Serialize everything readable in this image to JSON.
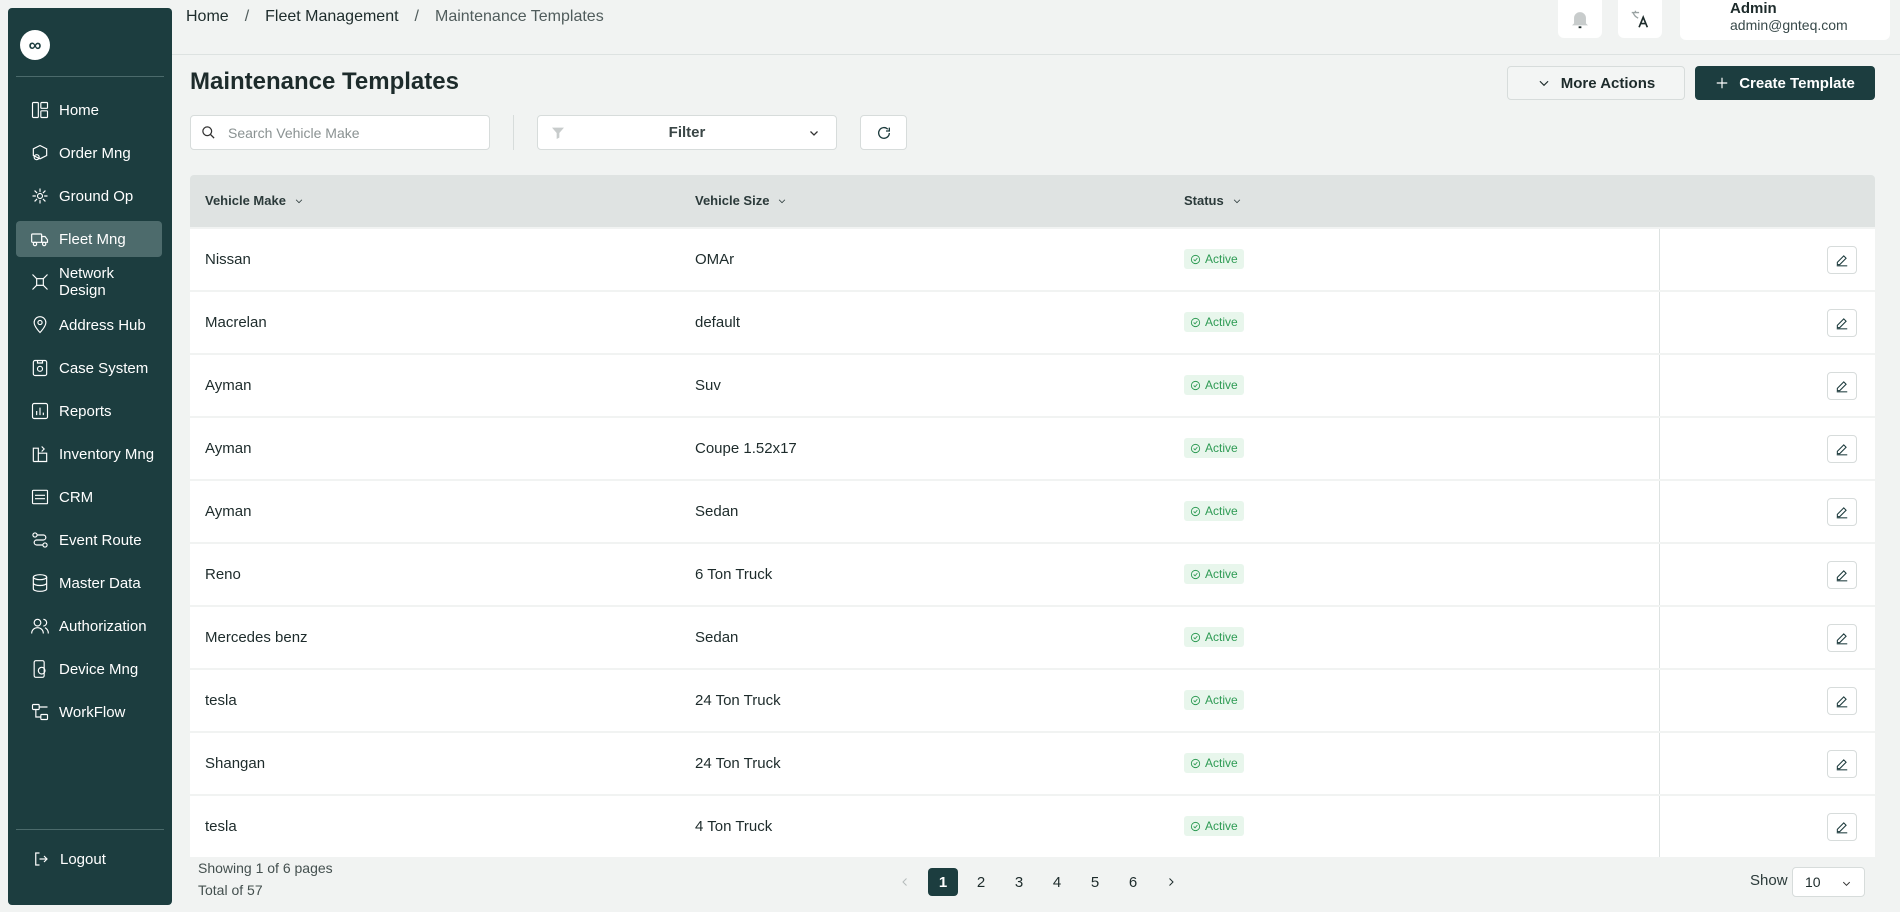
{
  "breadcrumb": {
    "home": "Home",
    "section": "Fleet Management",
    "current": "Maintenance Templates",
    "separator": "/"
  },
  "user": {
    "name": "Admin",
    "email": "admin@gnteq.com"
  },
  "sidebar": {
    "logo": "∞",
    "items": [
      {
        "label": "Home",
        "icon": "layout-grid-icon"
      },
      {
        "label": "Order Mng",
        "icon": "order-box-icon"
      },
      {
        "label": "Ground Op",
        "icon": "hub-network-icon"
      },
      {
        "label": "Fleet Mng",
        "icon": "truck-icon"
      },
      {
        "label": "Network Design",
        "icon": "network-icon"
      },
      {
        "label": "Address Hub",
        "icon": "map-pin-icon"
      },
      {
        "label": "Case System",
        "icon": "case-icon"
      },
      {
        "label": "Reports",
        "icon": "chart-icon"
      },
      {
        "label": "Inventory Mng",
        "icon": "inventory-icon"
      },
      {
        "label": "CRM",
        "icon": "crm-icon"
      },
      {
        "label": "Event Route",
        "icon": "route-icon"
      },
      {
        "label": "Master Data",
        "icon": "database-icon"
      },
      {
        "label": "Authorization",
        "icon": "users-icon"
      },
      {
        "label": "Device Mng",
        "icon": "device-gear-icon"
      },
      {
        "label": "WorkFlow",
        "icon": "workflow-icon"
      }
    ],
    "active": "Fleet Mng",
    "logout": "Logout"
  },
  "page": {
    "title": "Maintenance Templates"
  },
  "actions": {
    "more": "More Actions",
    "create": "Create Template"
  },
  "toolbar": {
    "search_placeholder": "Search Vehicle Make",
    "filter_label": "Filter"
  },
  "table": {
    "headers": {
      "make": "Vehicle Make",
      "size": "Vehicle Size",
      "status": "Status"
    },
    "rows": [
      {
        "make": "Nissan",
        "size": "OMAr",
        "status": "Active"
      },
      {
        "make": "Macrelan",
        "size": "default",
        "status": "Active"
      },
      {
        "make": "Ayman",
        "size": "Suv",
        "status": "Active"
      },
      {
        "make": "Ayman",
        "size": "Coupe 1.52x17",
        "status": "Active"
      },
      {
        "make": "Ayman",
        "size": "Sedan",
        "status": "Active"
      },
      {
        "make": "Reno",
        "size": "6 Ton Truck",
        "status": "Active"
      },
      {
        "make": "Mercedes benz",
        "size": "Sedan",
        "status": "Active"
      },
      {
        "make": "tesla",
        "size": "24 Ton Truck",
        "status": "Active"
      },
      {
        "make": "Shangan",
        "size": "24 Ton Truck",
        "status": "Active"
      },
      {
        "make": "tesla",
        "size": "4 Ton Truck",
        "status": "Active"
      }
    ]
  },
  "footer": {
    "showing": "Showing 1 of 6 pages",
    "total": "Total of 57",
    "pages": [
      "1",
      "2",
      "3",
      "4",
      "5",
      "6"
    ],
    "current_page": "1",
    "show_label": "Show",
    "page_size": "10"
  },
  "colors": {
    "primary": "#1c3d3f",
    "active_nav": "#4d6b6c",
    "status_green": "#2e9b54",
    "status_bg": "#e8f6ec"
  }
}
